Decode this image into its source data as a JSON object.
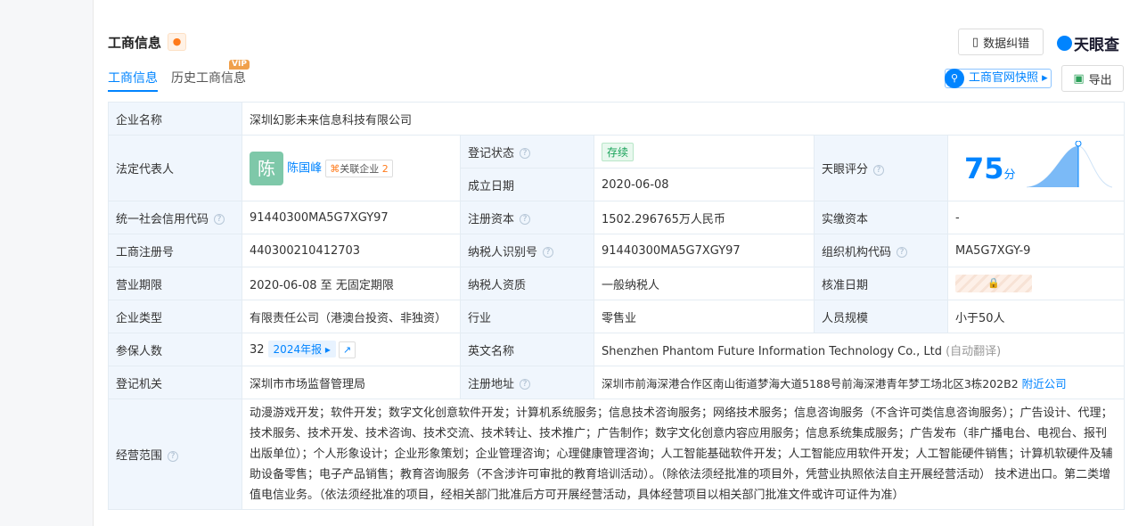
{
  "header": {
    "title": "工商信息",
    "correct_label": "数据纠错",
    "logo": "天眼查",
    "snapshot_label": "工商官网快照",
    "export_label": "导出"
  },
  "tabs": [
    {
      "label": "工商信息"
    },
    {
      "label": "历史工商信息",
      "badge": "VIP"
    }
  ],
  "table": {
    "company_name_label": "企业名称",
    "company_name": "深圳幻影未来信息科技有限公司",
    "legal_rep_label": "法定代表人",
    "legal_rep_avatar": "陈",
    "legal_rep": "陈国峰",
    "related_label": "关联企业",
    "related_count": "2",
    "reg_status_label": "登记状态",
    "reg_status": "存续",
    "found_date_label": "成立日期",
    "found_date": "2020-06-08",
    "score_label": "天眼评分",
    "score": "75",
    "score_unit": "分",
    "credit_code_label": "统一社会信用代码",
    "credit_code": "91440300MA5G7XGY97",
    "reg_capital_label": "注册资本",
    "reg_capital": "1502.296765万人民币",
    "paid_capital_label": "实缴资本",
    "paid_capital": "-",
    "reg_no_label": "工商注册号",
    "reg_no": "440300210412703",
    "taxpayer_id_label": "纳税人识别号",
    "taxpayer_id": "91440300MA5G7XGY97",
    "org_code_label": "组织机构代码",
    "org_code": "MA5G7XGY-9",
    "term_label": "营业期限",
    "term": "2020-06-08 至 无固定期限",
    "tax_qual_label": "纳税人资质",
    "tax_qual": "一般纳税人",
    "approve_date_label": "核准日期",
    "type_label": "企业类型",
    "type": "有限责任公司（港澳台投资、非独资）",
    "industry_label": "行业",
    "industry": "零售业",
    "staff_label": "人员规模",
    "staff": "小于50人",
    "insured_label": "参保人数",
    "insured": "32",
    "report_year": "2024年报",
    "en_name_label": "英文名称",
    "en_name": "Shenzhen Phantom Future Information Technology Co., Ltd",
    "en_note": "(自动翻译)",
    "authority_label": "登记机关",
    "authority": "深圳市市场监督管理局",
    "address_label": "注册地址",
    "address": "深圳市前海深港合作区南山街道梦海大道5188号前海深港青年梦工场北区3栋202B2",
    "nearby": "附近公司",
    "scope_label": "经营范围",
    "scope": "动漫游戏开发；软件开发；数字文化创意软件开发；计算机系统服务；信息技术咨询服务；网络技术服务；信息咨询服务（不含许可类信息咨询服务）；广告设计、代理；技术服务、技术开发、技术咨询、技术交流、技术转让、技术推广；广告制作；数字文化创意内容应用服务；信息系统集成服务；广告发布（非广播电台、电视台、报刊出版单位）；个人形象设计；企业形象策划；企业管理咨询；心理健康管理咨询；人工智能基础软件开发；人工智能应用软件开发；人工智能硬件销售；计算机软硬件及辅助设备零售；电子产品销售；教育咨询服务（不含涉许可审批的教育培训活动）。（除依法须经批准的项目外，凭营业执照依法自主开展经营活动） 技术进出口。第二类增值电信业务。（依法须经批准的项目，经相关部门批准后方可开展经营活动，具体经营项目以相关部门批准文件或许可证件为准）"
  }
}
